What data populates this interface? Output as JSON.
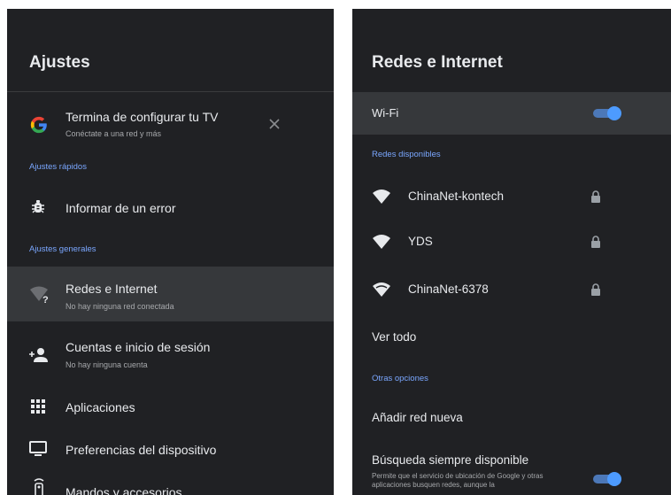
{
  "left": {
    "title": "Ajustes",
    "setup": {
      "label": "Termina de configurar tu TV",
      "sub": "Conéctate a una red y más",
      "close_icon": "close-icon",
      "icon": "google-g-icon"
    },
    "sections": {
      "quick": "Ajustes rápidos",
      "general": "Ajustes generales"
    },
    "items": [
      {
        "label": "Informar de un error",
        "sub": "",
        "icon": "bug-icon"
      },
      {
        "label": "Redes e Internet",
        "sub": "No hay ninguna red conectada",
        "icon": "wifi-question-icon"
      },
      {
        "label": "Cuentas e inicio de sesión",
        "sub": "No hay ninguna cuenta",
        "icon": "add-account-icon"
      },
      {
        "label": "Aplicaciones",
        "sub": "",
        "icon": "apps-grid-icon"
      },
      {
        "label": "Preferencias del dispositivo",
        "sub": "",
        "icon": "tv-icon"
      },
      {
        "label": "Mandos y accesorios",
        "sub": "",
        "icon": "remote-icon"
      }
    ]
  },
  "right": {
    "title": "Redes e Internet",
    "wifi": {
      "label": "Wi-Fi",
      "enabled": true
    },
    "sections": {
      "available": "Redes disponibles",
      "other": "Otras opciones"
    },
    "networks": [
      {
        "name": "ChinaNet-kontech",
        "locked": true
      },
      {
        "name": "YDS",
        "locked": true
      },
      {
        "name": "ChinaNet-6378",
        "locked": true
      }
    ],
    "see_all": "Ver todo",
    "add_network": "Añadir red nueva",
    "always_scan": {
      "label": "Búsqueda siempre disponible",
      "sub": "Permite que el servicio de ubicación de Google y otras aplicaciones busquen redes, aunque la",
      "enabled": true
    }
  },
  "colors": {
    "background": "#202124",
    "selected_row": "#36383b",
    "accent": "#7aa7ff",
    "toggle_on": "#4d9bff"
  }
}
